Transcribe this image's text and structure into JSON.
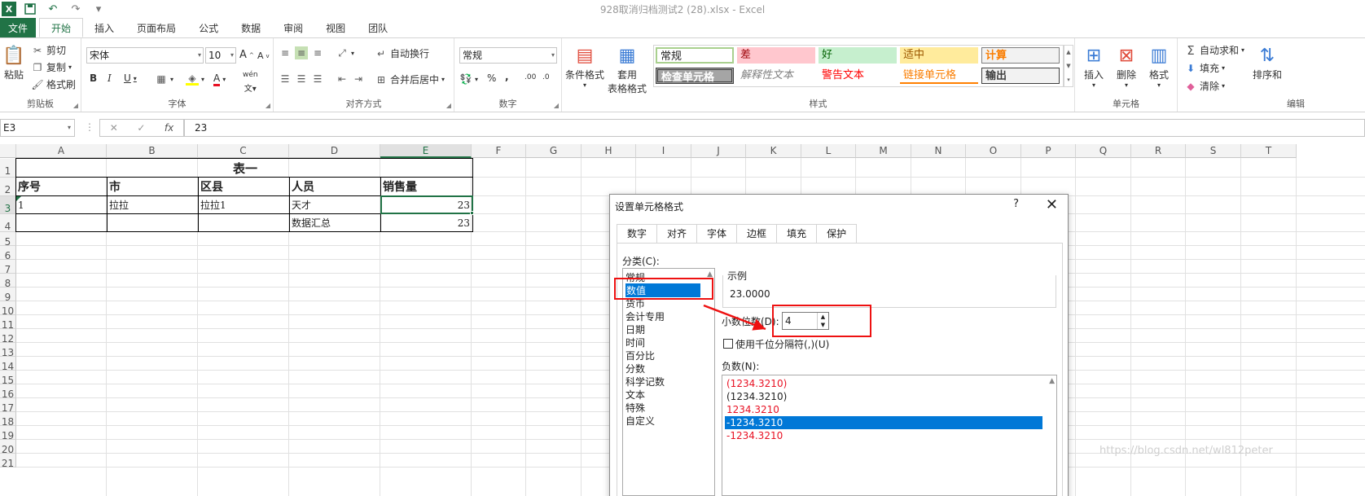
{
  "window": {
    "title": "928取消归档测试2 (28).xlsx - Excel"
  },
  "qat": {
    "logo": "X",
    "save_icon": "save-icon",
    "undo_icon": "undo-icon",
    "redo_icon": "redo-icon"
  },
  "tabs": [
    {
      "label": "文件"
    },
    {
      "label": "开始"
    },
    {
      "label": "插入"
    },
    {
      "label": "页面布局"
    },
    {
      "label": "公式"
    },
    {
      "label": "数据"
    },
    {
      "label": "审阅"
    },
    {
      "label": "视图"
    },
    {
      "label": "团队"
    }
  ],
  "ribbon": {
    "clipboard": {
      "paste": "粘贴",
      "cut": "剪切",
      "copy": "复制",
      "format_painter": "格式刷",
      "label": "剪贴板"
    },
    "font": {
      "name": "宋体",
      "size": "10",
      "bold": "B",
      "italic": "I",
      "underline": "U",
      "grow": "A",
      "shrink": "A",
      "font_color": "A",
      "phonetic": "wén",
      "label": "字体"
    },
    "alignment": {
      "wrap": "自动换行",
      "merge": "合并后居中",
      "label": "对齐方式"
    },
    "number": {
      "format": "常规",
      "percent": "%",
      "comma": ",",
      "inc": ".00",
      "dec": ".0",
      "label": "数字"
    },
    "styles": {
      "conditional": "条件格式",
      "table_line1": "套用",
      "table_line2": "表格格式",
      "cells": [
        "常规",
        "差",
        "好",
        "适中",
        "计算",
        "检查单元格",
        "解释性文本",
        "警告文本",
        "链接单元格",
        "输出"
      ],
      "label": "样式"
    },
    "cells": {
      "insert": "插入",
      "delete": "删除",
      "format": "格式",
      "label": "单元格"
    },
    "editing": {
      "autosum": "自动求和",
      "fill": "填充",
      "clear": "清除",
      "sort": "排序和",
      "label": "编辑"
    }
  },
  "formula_bar": {
    "name_box": "E3",
    "cancel": "✕",
    "enter": "✓",
    "fx": "fx",
    "value": "23"
  },
  "columns": [
    "A",
    "B",
    "C",
    "D",
    "E",
    "F",
    "G",
    "H",
    "I",
    "J",
    "K",
    "L",
    "M",
    "N",
    "O",
    "P",
    "Q",
    "R",
    "S",
    "T"
  ],
  "rows": [
    "1",
    "2",
    "3",
    "4",
    "5",
    "6",
    "7",
    "8",
    "9",
    "10",
    "11",
    "12",
    "13",
    "14",
    "15",
    "16",
    "17",
    "18",
    "19",
    "20",
    "21"
  ],
  "sheet": {
    "title": "表一",
    "headers": [
      "序号",
      "市",
      "区县",
      "人员",
      "销售量"
    ],
    "row3": [
      "1",
      "拉拉",
      "拉拉1",
      "天才",
      "23"
    ],
    "row4": [
      "",
      "",
      "",
      "数据汇总",
      "23"
    ]
  },
  "dialog": {
    "title": "设置单元格格式",
    "help": "?",
    "close": "✕",
    "tabs": [
      "数字",
      "对齐",
      "字体",
      "边框",
      "填充",
      "保护"
    ],
    "category_label": "分类(C):",
    "categories": [
      "常规",
      "数值",
      "货币",
      "会计专用",
      "日期",
      "时间",
      "百分比",
      "分数",
      "科学记数",
      "文本",
      "特殊",
      "自定义"
    ],
    "sample_label": "示例",
    "sample_value": "23.0000",
    "decimals_label": "小数位数(D):",
    "decimals_value": "4",
    "thousands_label": "使用千位分隔符(,)(U)",
    "negative_label": "负数(N):",
    "negatives": [
      "(1234.3210)",
      "(1234.3210)",
      "1234.3210",
      "-1234.3210",
      "-1234.3210"
    ],
    "negative_colors": [
      "#e81123",
      "#222222",
      "#e81123",
      "#ffffff",
      "#e81123"
    ]
  },
  "watermark": "https://blog.csdn.net/wl812peter"
}
